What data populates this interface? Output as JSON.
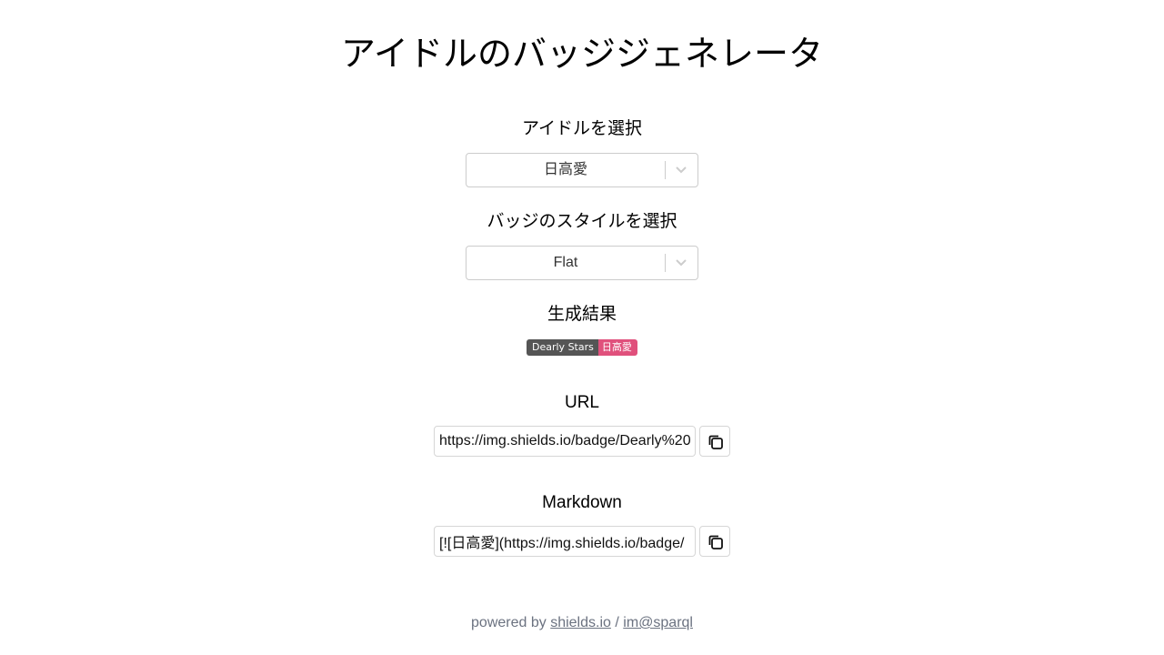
{
  "page": {
    "title": "アイドルのバッジジェネレータ"
  },
  "idol_select": {
    "label": "アイドルを選択",
    "value": "日高愛"
  },
  "style_select": {
    "label": "バッジのスタイルを選択",
    "value": "Flat"
  },
  "result": {
    "label": "生成結果",
    "badge": {
      "left_text": "Dearly Stars",
      "right_text": "日高愛",
      "left_color": "#555555",
      "right_color": "#e0507c"
    }
  },
  "url_field": {
    "label": "URL",
    "value": "https://img.shields.io/badge/Dearly%20"
  },
  "markdown_field": {
    "label": "Markdown",
    "value": "[![日高愛](https://img.shields.io/badge/"
  },
  "footer": {
    "prefix": "powered by",
    "link1": "shields.io",
    "separator": "/",
    "link2": "im@sparql"
  }
}
